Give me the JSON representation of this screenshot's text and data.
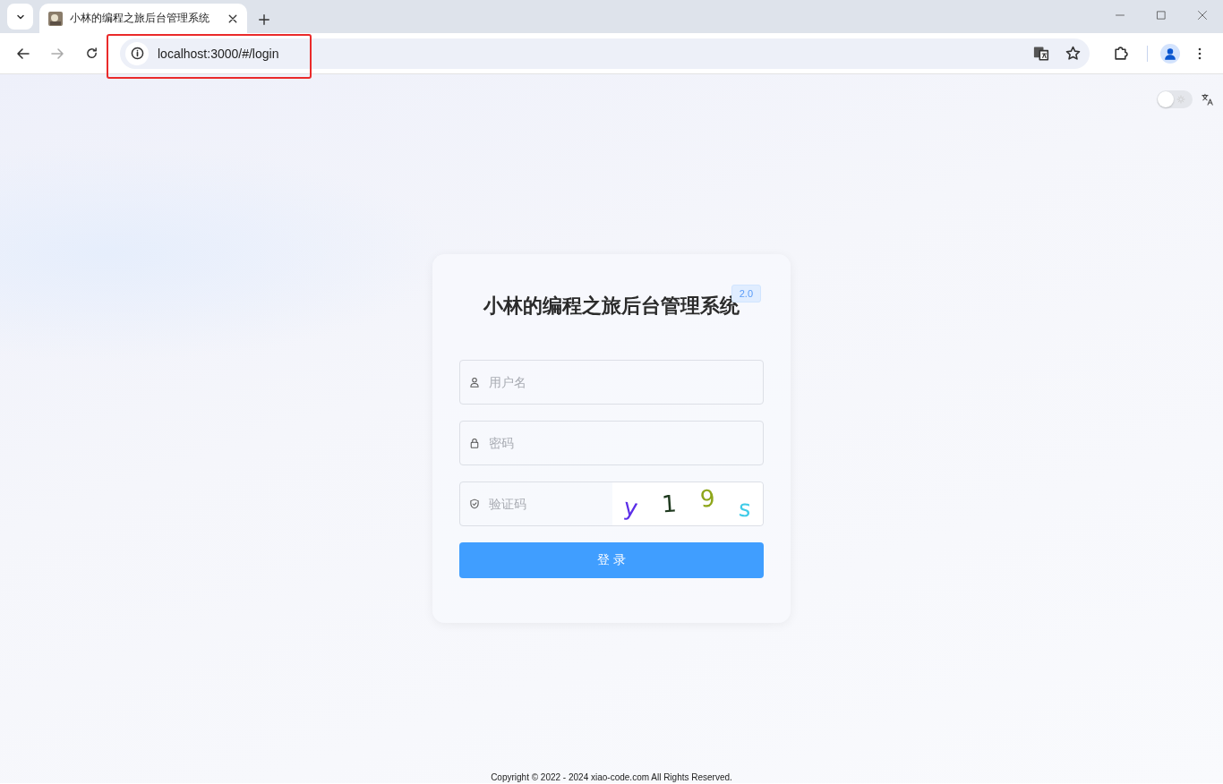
{
  "browser": {
    "tab_title": "小林的编程之旅后台管理系统",
    "url": "localhost:3000/#/login"
  },
  "theme_toggle": {
    "on": false
  },
  "login": {
    "title": "小林的编程之旅后台管理系统",
    "version": "2.0",
    "fields": [
      {
        "kind": "user",
        "placeholder": "用户名"
      },
      {
        "kind": "lock",
        "placeholder": "密码"
      },
      {
        "kind": "captcha",
        "placeholder": "验证码",
        "captcha": [
          {
            "char": "y",
            "color": "#5b2ee8"
          },
          {
            "char": "1",
            "color": "#1f3a1f"
          },
          {
            "char": "9",
            "color": "#8ea61a"
          },
          {
            "char": "s",
            "color": "#3fcbe8"
          }
        ]
      }
    ],
    "button": "登 录"
  },
  "footer": "Copyright © 2022 - 2024 xiao-code.com All Rights Reserved."
}
